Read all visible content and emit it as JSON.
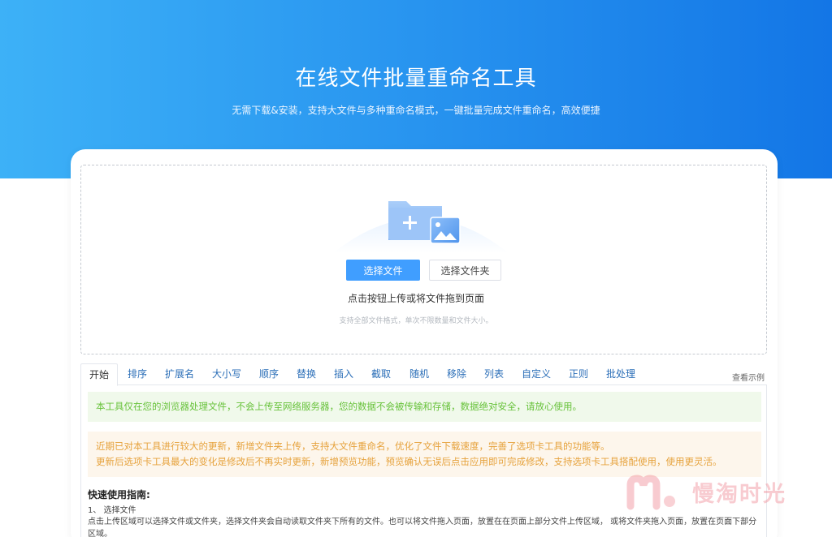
{
  "hero": {
    "title": "在线文件批量重命名工具",
    "subtitle": "无需下载&安装，支持大文件与多种重命名模式，一键批量完成文件重命名，高效便捷"
  },
  "upload": {
    "select_file_label": "选择文件",
    "select_folder_label": "选择文件夹",
    "hint": "点击按钮上传或将文件拖到页面",
    "sub_hint": "支持全部文件格式，单次不限数量和文件大小。",
    "illustration_icon": "folder-plus-image-icon"
  },
  "tabs": [
    {
      "label": "开始"
    },
    {
      "label": "排序"
    },
    {
      "label": "扩展名"
    },
    {
      "label": "大小写"
    },
    {
      "label": "顺序"
    },
    {
      "label": "替换"
    },
    {
      "label": "插入"
    },
    {
      "label": "截取"
    },
    {
      "label": "随机"
    },
    {
      "label": "移除"
    },
    {
      "label": "列表"
    },
    {
      "label": "自定义"
    },
    {
      "label": "正则"
    },
    {
      "label": "批处理"
    }
  ],
  "example_link": "查看示例",
  "notice": {
    "privacy": "本工具仅在您的浏览器处理文件，不会上传至网络服务器，您的数据不会被传输和存储，数据绝对安全，请放心使用。",
    "update_line1": "近期已对本工具进行较大的更新，新增文件夹上传，支持大文件重命名，优化了文件下载速度，完善了选项卡工具的功能等。",
    "update_line2": "更新后选项卡工具最大的变化是修改后不再实时更新，新增预览功能，预览确认无误后点击应用即可完成修改，支持选项卡工具搭配使用，使用更灵活。"
  },
  "guide": {
    "title": "快速使用指南:",
    "step1": "1、 选择文件",
    "step1_desc": "点击上传区域可以选择文件或文件夹，选择文件夹会自动读取文件夹下所有的文件。也可以将文件拖入页面，放置在在页面上部分文件上传区域， 或将文件夹拖入页面，放置在页面下部分区域。"
  },
  "watermark": {
    "text": "慢淘时光"
  },
  "colors": {
    "hero_start": "#3db1f7",
    "hero_end": "#1376e6",
    "primary": "#409eff",
    "success_text": "#67c23a",
    "warning_text": "#e6a23c"
  }
}
